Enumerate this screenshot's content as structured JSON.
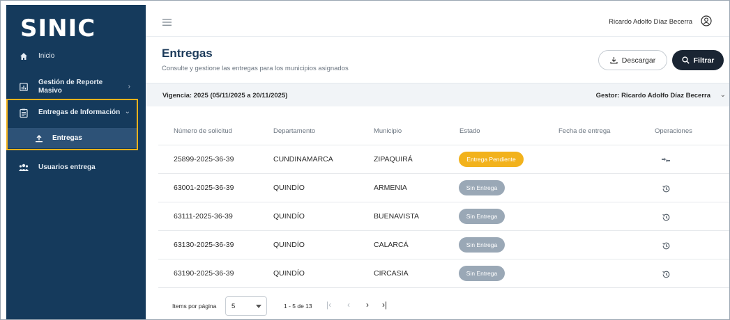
{
  "app": {
    "logo": "SINIC"
  },
  "sidebar": {
    "items": [
      {
        "label": "Inicio",
        "icon": "home-icon"
      },
      {
        "label": "Gestión de Reporte Masivo",
        "line1": "Gestión de Reporte",
        "line2": "Masivo",
        "icon": "report-icon"
      },
      {
        "label": "Entregas de Información",
        "icon": "clipboard-icon"
      },
      {
        "label": "Entregas",
        "icon": "upload-icon"
      },
      {
        "label": "Usuarios entrega",
        "icon": "users-icon"
      }
    ],
    "highlight_color": "#f2b21c"
  },
  "topbar": {
    "user_name": "Ricardo Adolfo Díaz Becerra"
  },
  "header": {
    "title": "Entregas",
    "subtitle": "Consulte y gestione las entregas para los municipios asignados",
    "download_label": "Descargar",
    "filter_label": "Filtrar"
  },
  "band": {
    "vigencia": "Vigencia: 2025 (05/11/2025 a 20/11/2025)",
    "gestor": "Gestor: Ricardo Adolfo Díaz Becerra"
  },
  "table": {
    "columns": [
      "Número de solicitud",
      "Departamento",
      "Municipio",
      "Estado",
      "Fecha de entrega",
      "Operaciones"
    ],
    "rows": [
      {
        "solicitud": "25899-2025-36-39",
        "departamento": "CUNDINAMARCA",
        "municipio": "ZIPAQUIRÁ",
        "estado": "Entrega Pendiente",
        "fecha": "",
        "operation_icon": "delivery-icon"
      },
      {
        "solicitud": "63001-2025-36-39",
        "departamento": "QUINDÍO",
        "municipio": "ARMENIA",
        "estado": "Sin Entrega",
        "fecha": "",
        "operation_icon": "history-icon"
      },
      {
        "solicitud": "63111-2025-36-39",
        "departamento": "QUINDÍO",
        "municipio": "BUENAVISTA",
        "estado": "Sin Entrega",
        "fecha": "",
        "operation_icon": "history-icon"
      },
      {
        "solicitud": "63130-2025-36-39",
        "departamento": "QUINDÍO",
        "municipio": "CALARCÁ",
        "estado": "Sin Entrega",
        "fecha": "",
        "operation_icon": "history-icon"
      },
      {
        "solicitud": "63190-2025-36-39",
        "departamento": "QUINDÍO",
        "municipio": "CIRCASIA",
        "estado": "Sin Entrega",
        "fecha": "",
        "operation_icon": "history-icon"
      }
    ],
    "status_colors": {
      "pending": "#f2b21c",
      "none": "#9aa8b6"
    }
  },
  "paginator": {
    "items_label": "Items por página",
    "page_size": "5",
    "range": "1 - 5 de 13"
  }
}
